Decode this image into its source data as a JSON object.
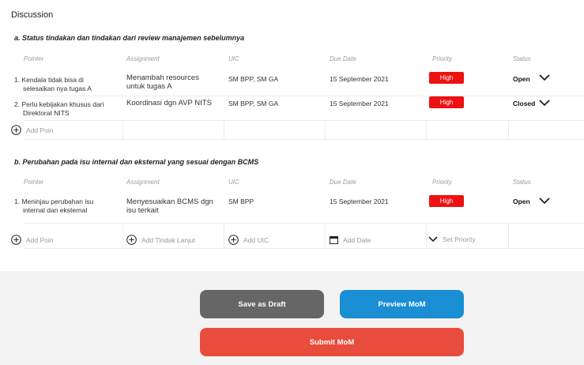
{
  "discussion_title": "Discussion",
  "headers": {
    "pointer": "Pointer",
    "assignment": "Assignment",
    "uic": "UIC",
    "due_date": "Due Date",
    "priority": "Priority",
    "status": "Status"
  },
  "section_a": {
    "title": "a. Status tindakan dan tindakan dari review manajemen sebelumnya",
    "rows": [
      {
        "pointer_line1": "1. Kendala tidak bisa di",
        "pointer_line2": "selesaikan nya tugas A",
        "assignment_line1": "Menambah resources",
        "assignment_line2": "untuk tugas A",
        "uic": "SM BPP, SM GA",
        "due_date": "15 September 2021",
        "priority": "High",
        "status": "Open"
      },
      {
        "pointer_line1": "2. Perlu kebijakan khusus dari",
        "pointer_line2": "Direktorat NITS",
        "assignment_line1": "Koordinasi dgn AVP NITS",
        "assignment_line2": "",
        "uic": "SM BPP, SM GA",
        "due_date": "15 September 2021",
        "priority": "High",
        "status": "Closed"
      }
    ],
    "add_poin": "Add Poin"
  },
  "section_b": {
    "title": "b. Perubahan pada isu internal dan eksternal yang sesuai dengan BCMS",
    "rows": [
      {
        "pointer_line1": "1. Meninjau perubahan isu",
        "pointer_line2": "internal dan eksternal",
        "assignment_line1": "Menyesuaikan BCMS dgn",
        "assignment_line2": "isu terkait",
        "uic": "SM BPP",
        "due_date": "15 September 2021",
        "priority": "High",
        "status": "Open"
      }
    ],
    "add_poin": "Add Poin",
    "add_tindak_lanjut": "Add Tindak Lanjut",
    "add_uic": "Add UIC",
    "add_date": "Add Date",
    "set_priority": "Set Priority"
  },
  "buttons": {
    "save_draft": "Save as Draft",
    "preview": "Preview MoM",
    "submit": "Submit MoM"
  },
  "colors": {
    "priority_high": "#ee1111",
    "draft_button": "#666666",
    "preview_button": "#1a8ed3",
    "submit_button": "#e84c3d"
  }
}
